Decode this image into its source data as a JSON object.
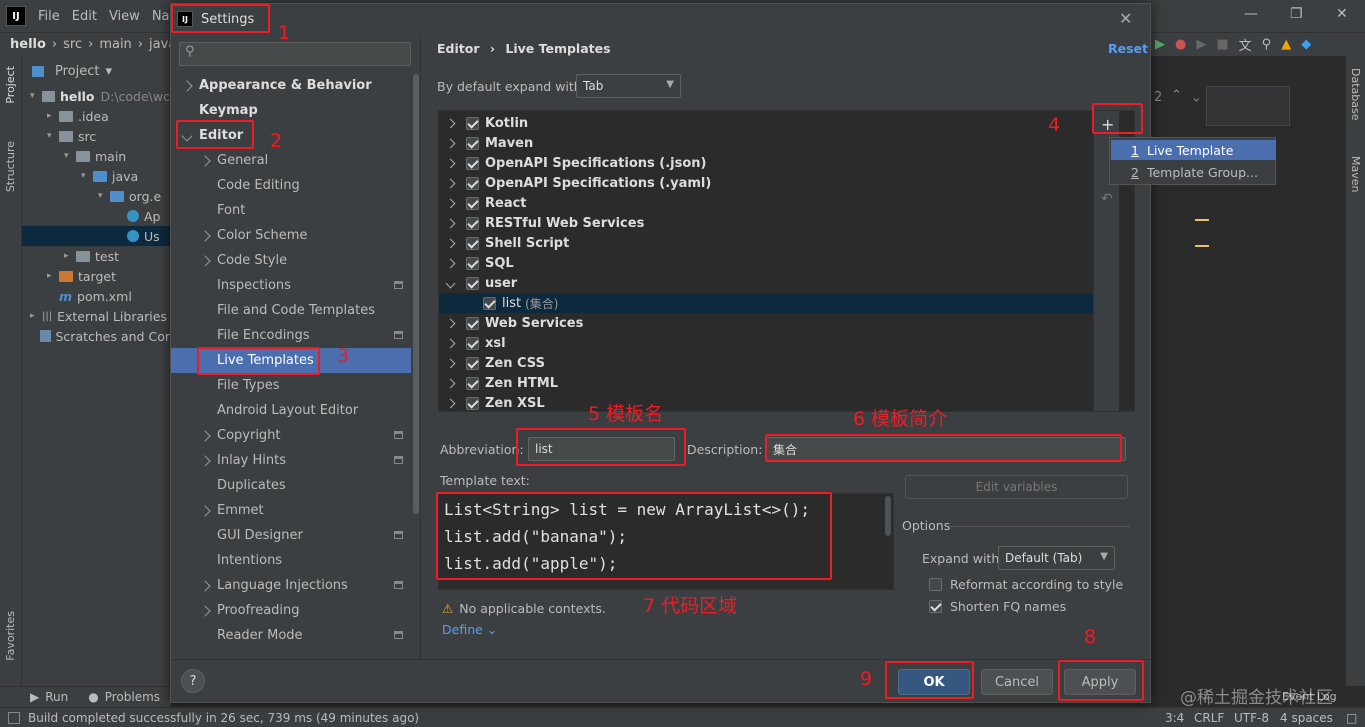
{
  "ide": {
    "menu": [
      "File",
      "Edit",
      "View",
      "Navi"
    ],
    "breadcrumb": [
      "hello",
      "src",
      "main",
      "java"
    ],
    "project_tool": "Project",
    "left_stripe": [
      "Project",
      "Structure",
      "Favorites"
    ],
    "right_stripe": [
      "Database",
      "Maven"
    ],
    "tree": [
      {
        "label": "hello",
        "path": "D:\\code\\wc",
        "level": 0,
        "kind": "folder"
      },
      {
        "label": ".idea",
        "level": 1,
        "kind": "folder"
      },
      {
        "label": "src",
        "level": 1,
        "kind": "folder"
      },
      {
        "label": "main",
        "level": 2,
        "kind": "folder"
      },
      {
        "label": "java",
        "level": 3,
        "kind": "folder-blue"
      },
      {
        "label": "org.e",
        "level": 4,
        "kind": "package"
      },
      {
        "label": "Ap",
        "level": 5,
        "kind": "class"
      },
      {
        "label": "Us",
        "level": 5,
        "kind": "class"
      },
      {
        "label": "test",
        "level": 2,
        "kind": "folder"
      },
      {
        "label": "target",
        "level": 1,
        "kind": "folder-orange"
      },
      {
        "label": "pom.xml",
        "level": 1,
        "kind": "maven"
      },
      {
        "label": "External Libraries",
        "level": 0,
        "kind": "lib"
      },
      {
        "label": "Scratches and Cor",
        "level": 0,
        "kind": "scratch"
      }
    ],
    "bottom_tools": [
      "Run",
      "Problems"
    ],
    "status_text": "Build completed successfully in 26 sec, 739 ms (49 minutes ago)",
    "status_right": [
      "3:4",
      "CRLF",
      "UTF-8",
      "4 spaces"
    ],
    "event_log": "Event Log",
    "editor_gutter": "2"
  },
  "dialog": {
    "title": "Settings",
    "search_placeholder": "",
    "nav": [
      {
        "label": "Appearance & Behavior",
        "bold": true,
        "chevron": "right",
        "indent": 0
      },
      {
        "label": "Keymap",
        "bold": true,
        "chevron": "none",
        "indent": 0
      },
      {
        "label": "Editor",
        "bold": true,
        "chevron": "down",
        "indent": 0
      },
      {
        "label": "General",
        "chevron": "right",
        "indent": 1
      },
      {
        "label": "Code Editing",
        "chevron": "none",
        "indent": 1
      },
      {
        "label": "Font",
        "chevron": "none",
        "indent": 1
      },
      {
        "label": "Color Scheme",
        "chevron": "right",
        "indent": 1
      },
      {
        "label": "Code Style",
        "chevron": "right",
        "indent": 1
      },
      {
        "label": "Inspections",
        "chevron": "none",
        "indent": 1,
        "project": true
      },
      {
        "label": "File and Code Templates",
        "chevron": "none",
        "indent": 1
      },
      {
        "label": "File Encodings",
        "chevron": "none",
        "indent": 1,
        "project": true
      },
      {
        "label": "Live Templates",
        "chevron": "none",
        "indent": 1,
        "selected": true
      },
      {
        "label": "File Types",
        "chevron": "none",
        "indent": 1
      },
      {
        "label": "Android Layout Editor",
        "chevron": "none",
        "indent": 1
      },
      {
        "label": "Copyright",
        "chevron": "right",
        "indent": 1,
        "project": true
      },
      {
        "label": "Inlay Hints",
        "chevron": "right",
        "indent": 1,
        "project": true
      },
      {
        "label": "Duplicates",
        "chevron": "none",
        "indent": 1
      },
      {
        "label": "Emmet",
        "chevron": "right",
        "indent": 1
      },
      {
        "label": "GUI Designer",
        "chevron": "none",
        "indent": 1,
        "project": true
      },
      {
        "label": "Intentions",
        "chevron": "none",
        "indent": 1
      },
      {
        "label": "Language Injections",
        "chevron": "right",
        "indent": 1,
        "project": true
      },
      {
        "label": "Proofreading",
        "chevron": "right",
        "indent": 1
      },
      {
        "label": "Reader Mode",
        "chevron": "none",
        "indent": 1,
        "project": true
      }
    ],
    "breadcrumb": [
      "Editor",
      "Live Templates"
    ],
    "reset_label": "Reset",
    "expand_label": "By default expand with",
    "expand_value": "Tab",
    "templates": [
      {
        "label": "Kotlin",
        "checked": true,
        "expanded": false,
        "child": false
      },
      {
        "label": "Maven",
        "checked": true,
        "expanded": false,
        "child": false
      },
      {
        "label": "OpenAPI Specifications (.json)",
        "checked": true,
        "expanded": false,
        "child": false
      },
      {
        "label": "OpenAPI Specifications (.yaml)",
        "checked": true,
        "expanded": false,
        "child": false
      },
      {
        "label": "React",
        "checked": true,
        "expanded": false,
        "child": false
      },
      {
        "label": "RESTful Web Services",
        "checked": true,
        "expanded": false,
        "child": false
      },
      {
        "label": "Shell Script",
        "checked": true,
        "expanded": false,
        "child": false
      },
      {
        "label": "SQL",
        "checked": true,
        "expanded": false,
        "child": false
      },
      {
        "label": "user",
        "checked": true,
        "expanded": true,
        "child": false
      },
      {
        "label": "list",
        "desc": "(集合)",
        "checked": true,
        "expanded": false,
        "child": true,
        "selected": true
      },
      {
        "label": "Web Services",
        "checked": true,
        "expanded": false,
        "child": false
      },
      {
        "label": "xsl",
        "checked": true,
        "expanded": false,
        "child": false
      },
      {
        "label": "Zen CSS",
        "checked": true,
        "expanded": false,
        "child": false
      },
      {
        "label": "Zen HTML",
        "checked": true,
        "expanded": false,
        "child": false
      },
      {
        "label": "Zen XSL",
        "checked": true,
        "expanded": false,
        "child": false
      }
    ],
    "add_popup": [
      {
        "num": "1",
        "label": "Live Template",
        "selected": true
      },
      {
        "num": "2",
        "label": "Template Group..."
      }
    ],
    "abbreviation_label": "Abbreviation:",
    "abbreviation_value": "list",
    "description_label": "Description:",
    "description_value": "集合",
    "template_text_label": "Template text:",
    "template_lines": [
      "List<String> list = new ArrayList<>();",
      "list.add(\"banana\");",
      "list.add(\"apple\");"
    ],
    "edit_variables": "Edit variables",
    "options_label": "Options",
    "expand_with_label": "Expand with",
    "expand_with_value": "Default (Tab)",
    "reformat_label": "Reformat according to style",
    "reformat_checked": false,
    "shorten_label": "Shorten FQ names",
    "shorten_checked": true,
    "warning": "No applicable contexts.",
    "define": "Define",
    "ok": "OK",
    "cancel": "Cancel",
    "apply": "Apply",
    "help": "?"
  },
  "annotations": {
    "n1": "1",
    "n2": "2",
    "n3": "3",
    "n4": "4",
    "n5": "5 模板名",
    "n6": "6 模板简介",
    "n7": "7 代码区域",
    "n8": "8",
    "n9": "9",
    "watermark": "@稀土掘金技术社区",
    "color": "#ee1c25"
  }
}
